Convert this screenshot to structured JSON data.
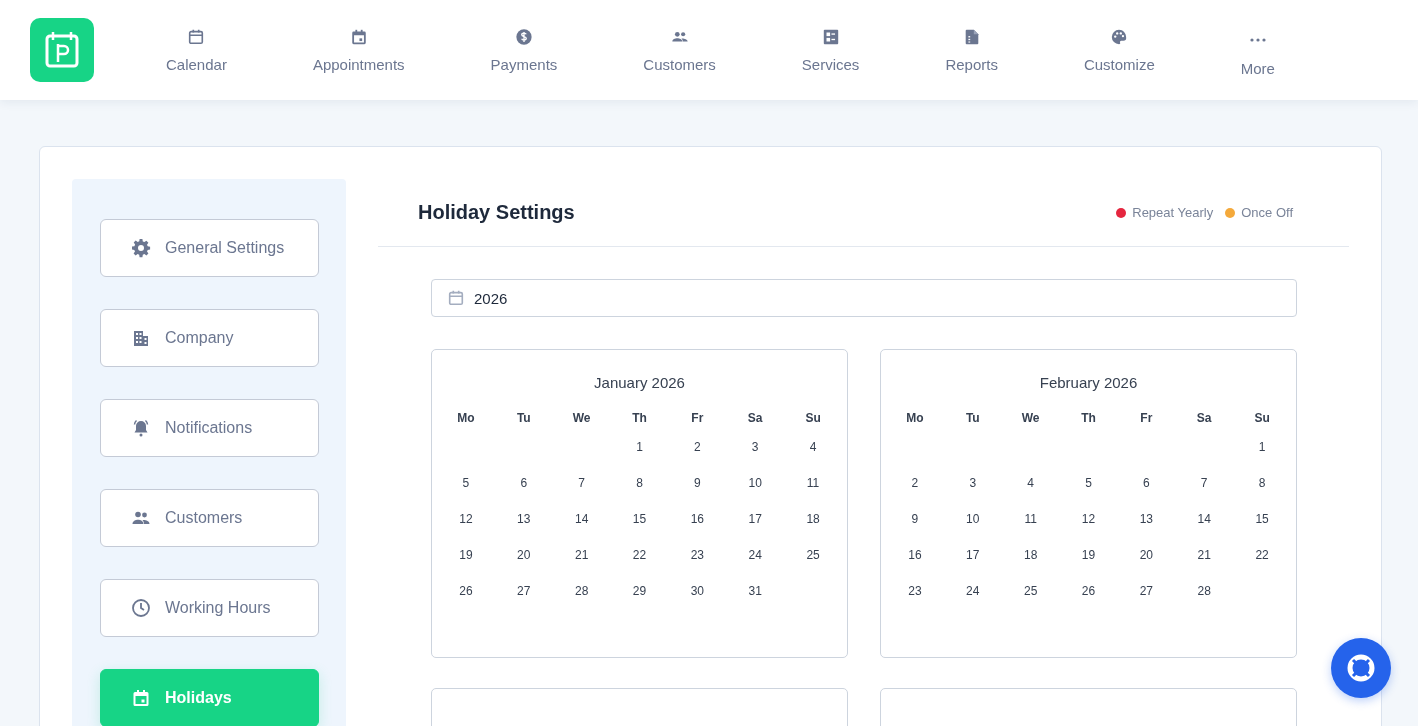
{
  "nav": [
    {
      "label": "Calendar"
    },
    {
      "label": "Appointments"
    },
    {
      "label": "Payments"
    },
    {
      "label": "Customers"
    },
    {
      "label": "Services"
    },
    {
      "label": "Reports"
    },
    {
      "label": "Customize"
    },
    {
      "label": "More"
    }
  ],
  "sidebar": {
    "items": [
      {
        "label": "General Settings",
        "selected": false
      },
      {
        "label": "Company",
        "selected": false
      },
      {
        "label": "Notifications",
        "selected": false
      },
      {
        "label": "Customers",
        "selected": false
      },
      {
        "label": "Working Hours",
        "selected": false
      },
      {
        "label": "Holidays",
        "selected": true
      }
    ]
  },
  "page_title": "Holiday Settings",
  "legend": [
    {
      "label": "Repeat Yearly",
      "color": "#e5263f"
    },
    {
      "label": "Once Off",
      "color": "#f4a93b"
    }
  ],
  "year_field": {
    "value": "2026"
  },
  "calendars": [
    {
      "kind": "month",
      "title": "January 2026",
      "weekdays": [
        "Mo",
        "Tu",
        "We",
        "Th",
        "Fr",
        "Sa",
        "Su"
      ],
      "weeks": [
        {
          "kind": "leading",
          "days": [
            "1",
            "2",
            "3",
            "4"
          ]
        },
        {
          "kind": "full",
          "days": [
            "5",
            "6",
            "7",
            "8",
            "9",
            "10",
            "11"
          ]
        },
        {
          "kind": "full",
          "days": [
            "12",
            "13",
            "14",
            "15",
            "16",
            "17",
            "18"
          ]
        },
        {
          "kind": "full",
          "days": [
            "19",
            "20",
            "21",
            "22",
            "23",
            "24",
            "25"
          ]
        },
        {
          "kind": "full",
          "days": [
            "26",
            "27",
            "28",
            "29",
            "30",
            "31"
          ]
        }
      ]
    },
    {
      "kind": "month",
      "title": "February 2026",
      "weekdays": [
        "Mo",
        "Tu",
        "We",
        "Th",
        "Fr",
        "Sa",
        "Su"
      ],
      "weeks": [
        {
          "kind": "leading",
          "days": [
            "1"
          ]
        },
        {
          "kind": "full",
          "days": [
            "2",
            "3",
            "4",
            "5",
            "6",
            "7",
            "8"
          ]
        },
        {
          "kind": "full",
          "days": [
            "9",
            "10",
            "11",
            "12",
            "13",
            "14",
            "15"
          ]
        },
        {
          "kind": "full",
          "days": [
            "16",
            "17",
            "18",
            "19",
            "20",
            "21",
            "22"
          ]
        },
        {
          "kind": "full",
          "days": [
            "23",
            "24",
            "25",
            "26",
            "27",
            "28"
          ]
        }
      ]
    },
    {
      "kind": "cut"
    },
    {
      "kind": "cut"
    }
  ]
}
